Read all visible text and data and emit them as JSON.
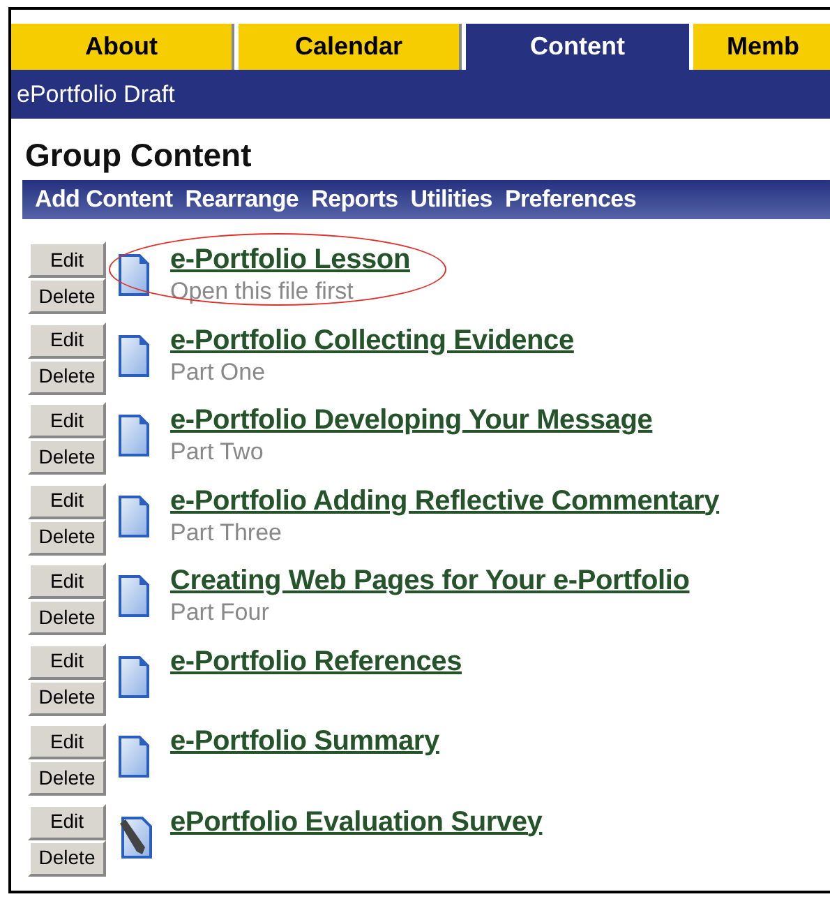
{
  "tabs": [
    {
      "label": "About",
      "selected": false
    },
    {
      "label": "Calendar",
      "selected": false
    },
    {
      "label": "Content",
      "selected": true
    },
    {
      "label": "Memb",
      "selected": false
    }
  ],
  "subheader": "ePortfolio Draft",
  "heading": "Group Content",
  "toolbar": [
    "Add Content",
    "Rearrange",
    "Reports",
    "Utilities",
    "Preferences"
  ],
  "items": [
    {
      "title": "e-Portfolio Lesson",
      "subtitle": "Open this file first",
      "kind": "document",
      "circled": true,
      "edit": "Edit",
      "delete": "Delete"
    },
    {
      "title": "e-Portfolio Collecting Evidence",
      "subtitle": "Part One",
      "kind": "document",
      "circled": false,
      "edit": "Edit",
      "delete": "Delete"
    },
    {
      "title": "e-Portfolio Developing Your Message",
      "subtitle": "Part Two",
      "kind": "document",
      "circled": false,
      "edit": "Edit",
      "delete": "Delete"
    },
    {
      "title": "e-Portfolio Adding Reflective Commentary",
      "subtitle": "Part Three",
      "kind": "document",
      "circled": false,
      "edit": "Edit",
      "delete": "Delete"
    },
    {
      "title": "Creating Web Pages for Your e-Portfolio",
      "subtitle": "Part Four",
      "kind": "document",
      "circled": false,
      "edit": "Edit",
      "delete": "Delete"
    },
    {
      "title": "e-Portfolio References",
      "kind": "document",
      "circled": false,
      "edit": "Edit",
      "delete": "Delete"
    },
    {
      "title": "e-Portfolio Summary",
      "kind": "document",
      "circled": false,
      "edit": "Edit",
      "delete": "Delete"
    },
    {
      "title": "ePortfolio Evaluation Survey",
      "kind": "survey",
      "circled": false,
      "edit": "Edit",
      "delete": "Delete"
    }
  ]
}
